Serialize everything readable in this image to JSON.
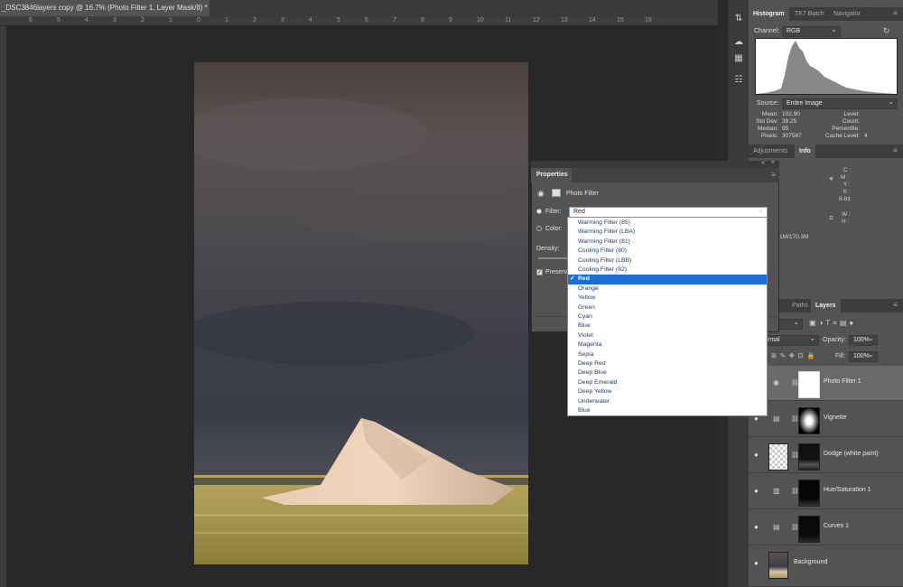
{
  "document": {
    "tab_title": "_DSC3846layers copy @ 16.7% (Photo Filter 1, Layer Mask/8) *",
    "close_glyph": "×",
    "ruler_ticks": [
      "6",
      "5",
      "4",
      "3",
      "2",
      "1",
      "0",
      "1",
      "2",
      "3",
      "4",
      "5",
      "6",
      "7",
      "8",
      "9",
      "10",
      "11",
      "12",
      "13",
      "14",
      "15",
      "16"
    ]
  },
  "histogram_panel": {
    "tabs": [
      "Histogram",
      "TK7 Batch",
      "Navigator"
    ],
    "channel_label": "Channel:",
    "channel_value": "RGB",
    "source_label": "Source:",
    "source_value": "Entire Image",
    "stats_left": [
      {
        "label": "Mean:",
        "value": "102.90"
      },
      {
        "label": "Std Dev:",
        "value": "38.25"
      },
      {
        "label": "Median:",
        "value": "95"
      },
      {
        "label": "Pixels:",
        "value": "307587"
      }
    ],
    "stats_right": [
      {
        "label": "Level:",
        "value": ""
      },
      {
        "label": "Count:",
        "value": ""
      },
      {
        "label": "Percentile:",
        "value": ""
      },
      {
        "label": "Cache Level:",
        "value": "4"
      }
    ]
  },
  "info_panel": {
    "tabs": [
      "Adjustments",
      "Info"
    ],
    "cmyk": [
      "C :",
      "M :",
      "Y :",
      "K :"
    ],
    "bitdepth": "8-bit",
    "wh": [
      "W :",
      "H :"
    ],
    "doc_size": "1M/170.3M"
  },
  "layers_panel": {
    "tabs": [
      "Paths",
      "Layers"
    ],
    "blend_mode": "rmal",
    "opacity_label": "Opacity:",
    "opacity_value": "100%",
    "fill_label": "Fill:",
    "fill_value": "100%",
    "layers": [
      {
        "name": "Photo Filter 1"
      },
      {
        "name": "Vignette"
      },
      {
        "name": "Dodge (white paint)"
      },
      {
        "name": "Hue/Saturation 1"
      },
      {
        "name": "Curves 1"
      },
      {
        "name": "Background"
      }
    ]
  },
  "properties_panel": {
    "tab": "Properties",
    "adjustment_title": "Photo Filter",
    "filter_label": "Filter:",
    "filter_value": "Red",
    "color_label": "Color:",
    "density_label": "Density:",
    "preserve_label": "Preserve",
    "options": [
      "Warming Filter (85)",
      "Warming Filter (LBA)",
      "Warming Filter (81)",
      "Cooling Filter (80)",
      "Cooling Filter (LBB)",
      "Cooling Filter (82)",
      "Red",
      "Orange",
      "Yellow",
      "Green",
      "Cyan",
      "Blue",
      "Violet",
      "Magenta",
      "Sepia",
      "Deep Red",
      "Deep Blue",
      "Deep Emerald",
      "Deep Yellow",
      "Underwater",
      "Blue"
    ],
    "selected_index": 6,
    "check_glyph": "✓"
  },
  "icons": {
    "strip": [
      "adjust-icon",
      "swatch-icon",
      "grid-icon",
      "layer-comps-icon"
    ],
    "eye": "eye-icon",
    "chain": "link-icon"
  },
  "colors": {
    "selected_item": "#1c6ed2",
    "panel_bg": "#535353",
    "canvas_bg": "#282828"
  }
}
